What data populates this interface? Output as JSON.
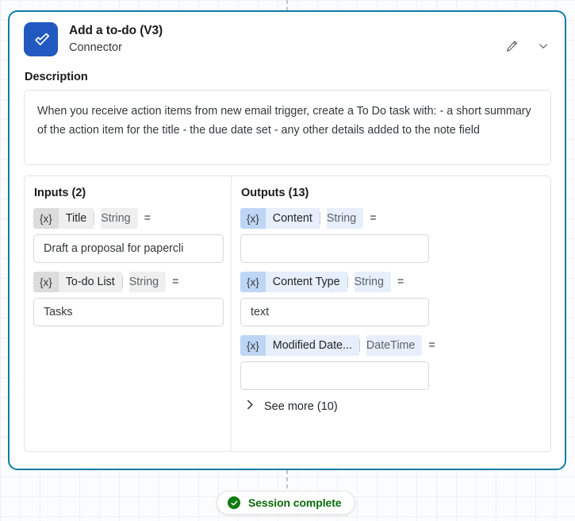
{
  "canvas": {
    "connector_top": "dashed-line",
    "connector_bottom": "dashed-line",
    "grid": "25px"
  },
  "card": {
    "border_color": "#0f7ba6",
    "icon_color": "#2259c0",
    "icon_name": "todo-check-icon",
    "title": "Add a to-do (V3)",
    "subtitle": "Connector",
    "actions": [
      {
        "name": "edit-icon",
        "label": "Edit"
      },
      {
        "name": "chevron-down-icon",
        "label": "Collapse"
      }
    ]
  },
  "description": {
    "label": "Description",
    "text": "When you receive action items from new email trigger, create a To Do task with: - a short summary of the action item for the title - the due date set - any other details added to the note field"
  },
  "inputs": {
    "title": "Inputs (2)",
    "chip_style": "gray",
    "rows": [
      {
        "badge": "{x}",
        "name": "Title",
        "type": "String",
        "eq": "=",
        "value": "Draft a proposal for papercli"
      },
      {
        "badge": "{x}",
        "name": "To-do List",
        "type": "String",
        "eq": "=",
        "value": "Tasks"
      }
    ]
  },
  "outputs": {
    "title": "Outputs (13)",
    "chip_style": "blue",
    "rows": [
      {
        "badge": "{x}",
        "name": "Content",
        "type": "String",
        "eq": "=",
        "value": ""
      },
      {
        "badge": "{x}",
        "name": "Content Type",
        "type": "String",
        "eq": "=",
        "value": "text"
      },
      {
        "badge": "{x}",
        "name": "Modified Date...",
        "type": "DateTime",
        "eq": "=",
        "value": ""
      }
    ],
    "see_more": {
      "label": "See more (10)",
      "icon": "chevron-right-icon"
    }
  },
  "status": {
    "icon": "check-circle-icon",
    "label": "Session complete",
    "color": "#107c10"
  }
}
